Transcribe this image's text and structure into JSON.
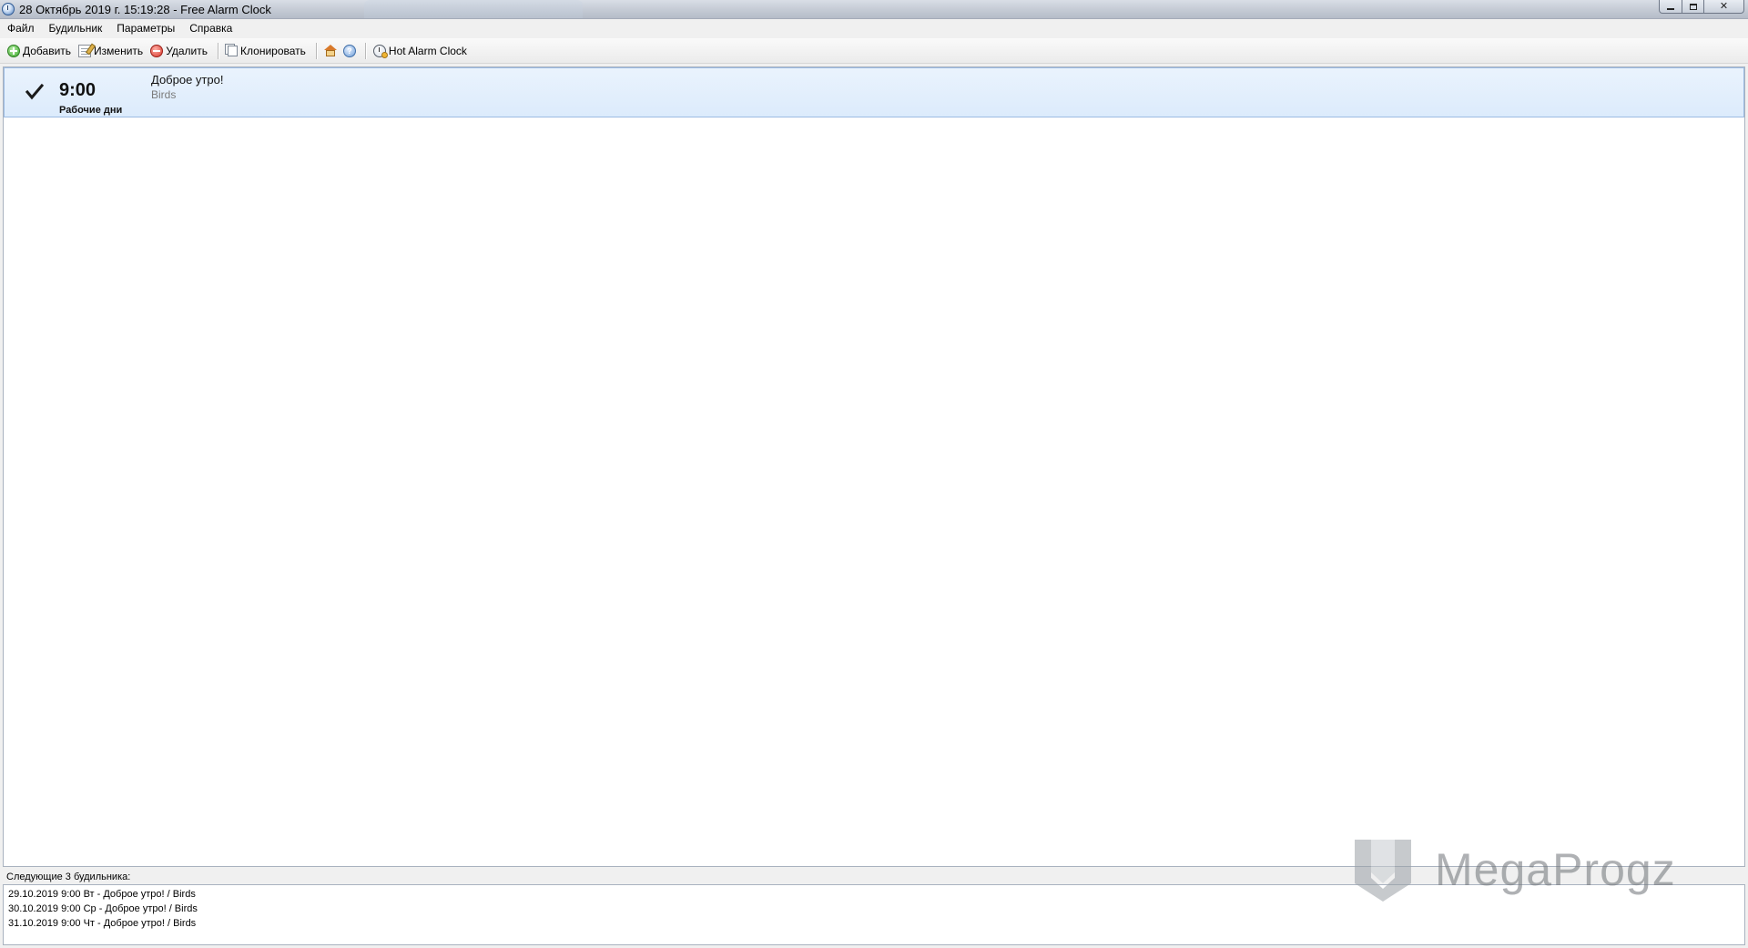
{
  "window": {
    "title": "28 Октябрь 2019 г. 15:19:28 - Free Alarm Clock",
    "icon": "alarm-clock-icon"
  },
  "menu": {
    "items": [
      "Файл",
      "Будильник",
      "Параметры",
      "Справка"
    ]
  },
  "toolbar": {
    "add_label": "Добавить",
    "edit_label": "Изменить",
    "delete_label": "Удалить",
    "clone_label": "Клонировать",
    "hot_label": "Hot Alarm Clock",
    "icons": [
      "add-icon",
      "edit-icon",
      "delete-icon",
      "clone-icon",
      "home-icon",
      "help-icon",
      "hot-alarm-clock-icon"
    ]
  },
  "alarms": [
    {
      "enabled": true,
      "time": "9:00",
      "repeat": "Рабочие дни",
      "label": "Доброе утро!",
      "sound": "Birds"
    }
  ],
  "next_alarms": {
    "title": "Следующие 3 будильника:",
    "items": [
      "29.10.2019 9:00 Вт - Доброе утро! / Birds",
      "30.10.2019 9:00 Ср - Доброе утро! / Birds",
      "31.10.2019 9:00 Чт - Доброе утро! / Birds"
    ]
  },
  "watermark": {
    "text": "MegaProgz"
  },
  "colors": {
    "selected_row": "#dcebfc",
    "selected_row_border": "#9cbbe2"
  }
}
